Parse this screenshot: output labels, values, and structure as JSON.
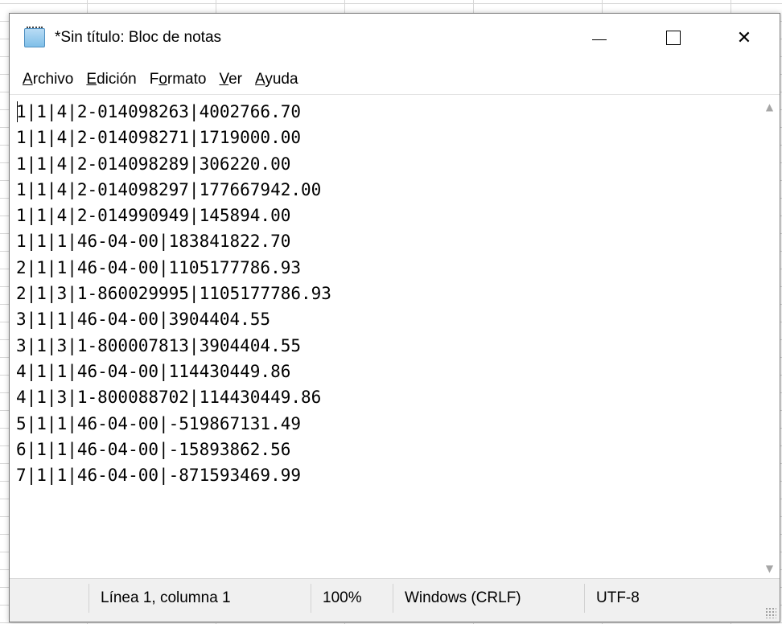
{
  "window": {
    "title": "*Sin título: Bloc de notas",
    "icon": "notepad-icon",
    "controls": {
      "minimize_icon": "minimize-icon",
      "maximize_icon": "maximize-icon",
      "close_glyph": "✕"
    }
  },
  "menu": [
    {
      "accel": "A",
      "rest": "rchivo"
    },
    {
      "accel": "E",
      "rest": "dición"
    },
    {
      "pre": "F",
      "accel": "o",
      "rest": "rmato"
    },
    {
      "accel": "V",
      "rest": "er"
    },
    {
      "accel": "A",
      "rest": "yuda"
    }
  ],
  "editor": {
    "content": "1|1|4|2-014098263|4002766.70\n1|1|4|2-014098271|1719000.00\n1|1|4|2-014098289|306220.00\n1|1|4|2-014098297|177667942.00\n1|1|4|2-014990949|145894.00\n1|1|1|46-04-00|183841822.70\n2|1|1|46-04-00|1105177786.93\n2|1|3|1-860029995|1105177786.93\n3|1|1|46-04-00|3904404.55\n3|1|3|1-800007813|3904404.55\n4|1|1|46-04-00|114430449.86\n4|1|3|1-800088702|114430449.86\n5|1|1|46-04-00|-519867131.49\n6|1|1|46-04-00|-15893862.56\n7|1|1|46-04-00|-871593469.99"
  },
  "scrollbar": {
    "up_glyph": "▲",
    "down_glyph": "▼"
  },
  "status": {
    "position": "Línea 1, columna 1",
    "zoom": "100%",
    "line_ending": "Windows (CRLF)",
    "encoding": "UTF-8"
  }
}
